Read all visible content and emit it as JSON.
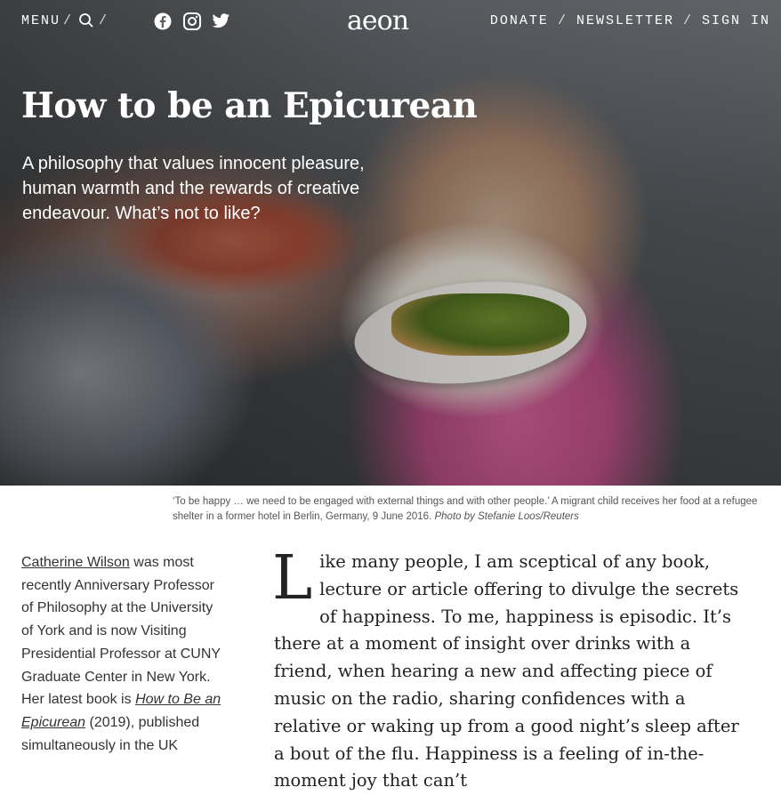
{
  "nav": {
    "menu": "MENU",
    "separator": "/",
    "logo": "aeon",
    "donate": "DONATE",
    "newsletter": "NEWSLETTER",
    "sign_in": "SIGN IN",
    "icons": [
      "search-icon",
      "facebook-icon",
      "instagram-icon",
      "twitter-icon"
    ]
  },
  "hero": {
    "title": "How to be an Epicurean",
    "subtitle": "A philosophy that values innocent pleasure, human warmth and the rewards of creative endeavour. What’s not to like?"
  },
  "caption": {
    "text": "‘To be happy … we need to be engaged with external things and with other people.’ A migrant child receives her food at a refugee shelter in a former hotel in Berlin, Germany, 9 June 2016.",
    "credit": "Photo by Stefanie Loos/Reuters"
  },
  "author": {
    "name": "Catherine Wilson",
    "bio_1": " was most recently Anniversary Professor of Philosophy at the University of York and is now Visiting Presidential Professor at CUNY Graduate Center in New York. Her latest book is ",
    "book": "How to Be an Epicurean",
    "bio_2": " (2019), published simultaneously in the UK"
  },
  "article": {
    "dropcap": "L",
    "text": "ike many people, I am sceptical of any book, lecture or article offering to divulge the secrets of happiness. To me, happiness is episodic. It’s there at a moment of insight over drinks with a friend, when hearing a new and affecting piece of music on the radio, sharing confidences with a relative or waking up from a good night’s sleep after a bout of the flu. Happiness is a feeling of in-the-moment joy that can’t"
  },
  "colors": {
    "text": "#222222",
    "caption": "#555555",
    "nav_text": "#ffffff"
  }
}
